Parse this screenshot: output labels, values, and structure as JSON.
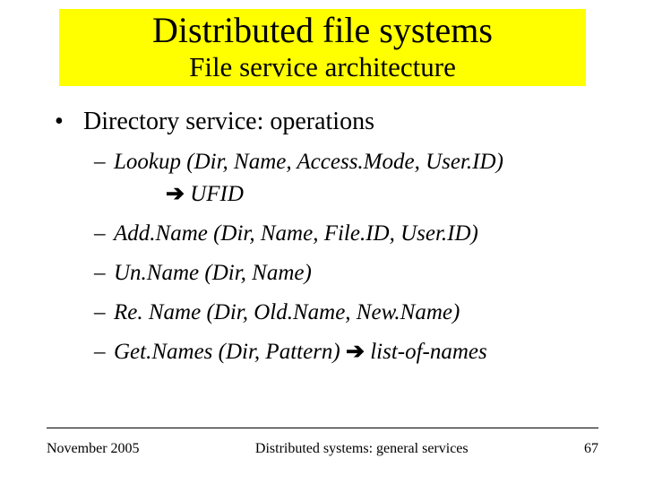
{
  "title": {
    "main": "Distributed file systems",
    "sub": "File service architecture"
  },
  "heading": "Directory service: operations",
  "ops": {
    "lookup": "Lookup (Dir, Name, Access.Mode, User.ID)",
    "lookup_result": "UFID",
    "addname": "Add.Name (Dir, Name, File.ID, User.ID)",
    "unname": "Un.Name (Dir, Name)",
    "rename": "Re. Name (Dir, Old.Name, New.Name)",
    "getnames_pre": "Get.Names (Dir, Pattern) ",
    "getnames_post": " list-of-names"
  },
  "symbols": {
    "arrow": "➔",
    "bullet": "•",
    "dash": "–"
  },
  "footer": {
    "date": "November 2005",
    "course": "Distributed systems: general services",
    "page": "67"
  }
}
